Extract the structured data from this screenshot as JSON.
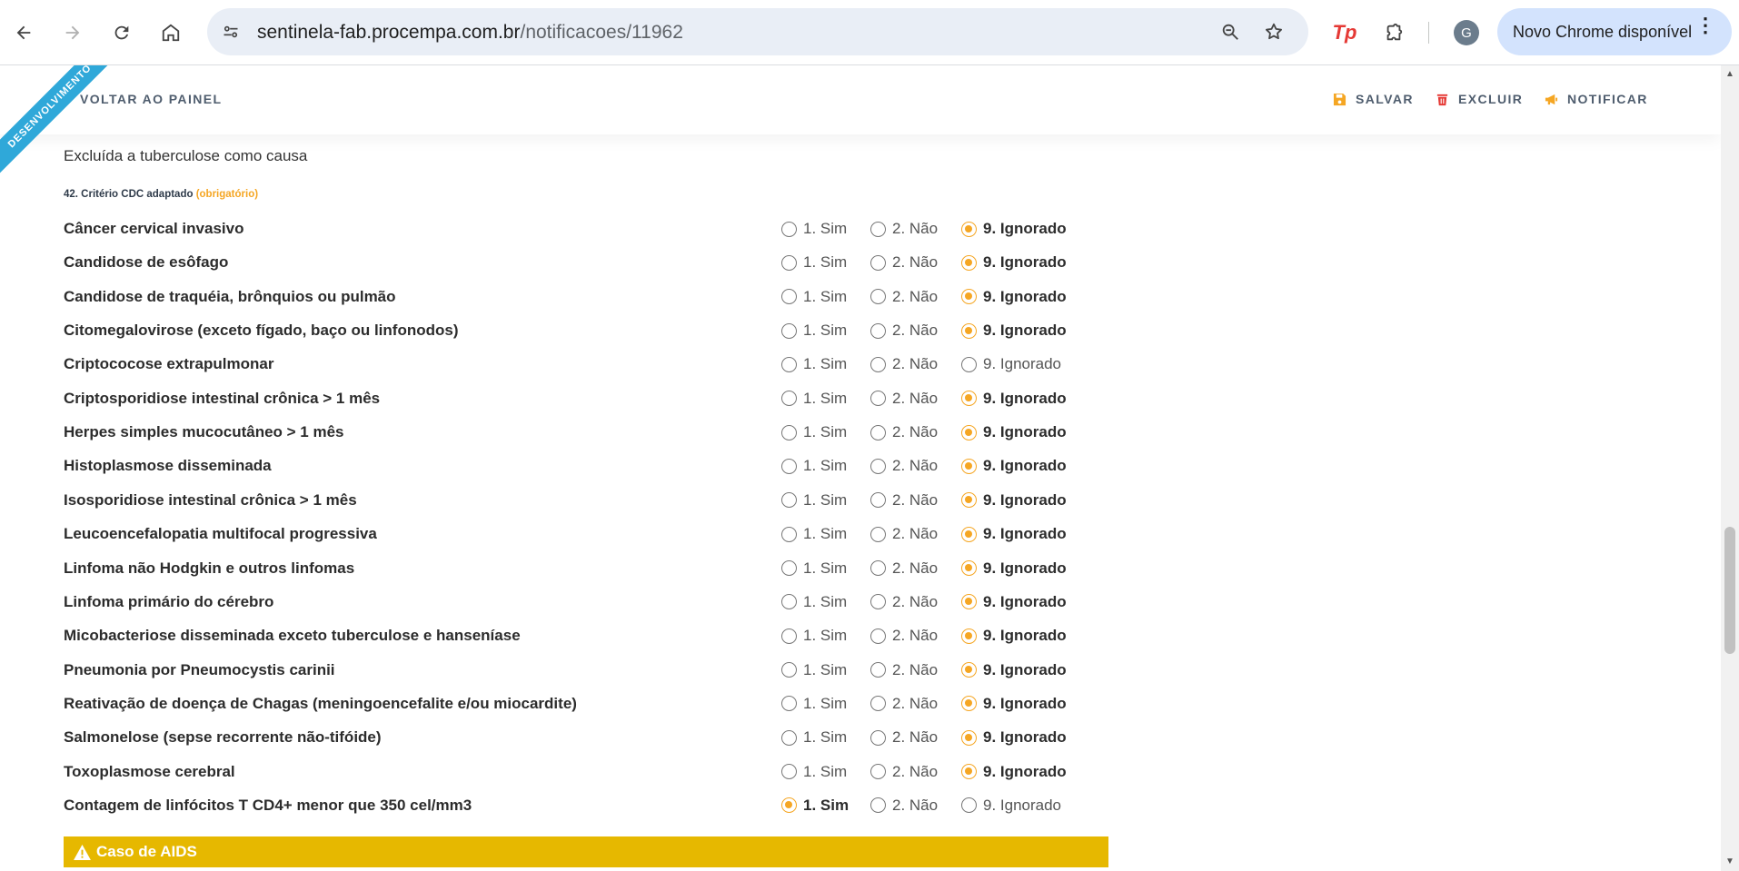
{
  "browser": {
    "url_host": "sentinela-fab.procempa.com.br",
    "url_path": "/notificacoes/11962",
    "profile_initial": "G",
    "update_label": "Novo Chrome disponível"
  },
  "header": {
    "ribbon": "DESENVOLVIMENTO",
    "back_label": "VOLTAR AO PAINEL",
    "save_label": "SALVAR",
    "delete_label": "EXCLUIR",
    "notify_label": "NOTIFICAR",
    "accent_color": "#f5a623"
  },
  "form": {
    "previous_field_text": "Excluída a tuberculose como causa",
    "section_label": "42. Critério CDC adaptado",
    "section_required": "(obrigatório)",
    "options": [
      "1. Sim",
      "2. Não",
      "9. Ignorado"
    ],
    "rows": [
      {
        "label": "Câncer cervical invasivo",
        "selected": 2
      },
      {
        "label": "Candidose de esôfago",
        "selected": 2
      },
      {
        "label": "Candidose de traquéia, brônquios ou pulmão",
        "selected": 2
      },
      {
        "label": "Citomegalovirose (exceto fígado, baço ou linfonodos)",
        "selected": 2
      },
      {
        "label": "Criptococose extrapulmonar",
        "selected": -1
      },
      {
        "label": "Criptosporidiose intestinal crônica > 1 mês",
        "selected": 2
      },
      {
        "label": "Herpes simples mucocutâneo > 1 mês",
        "selected": 2
      },
      {
        "label": "Histoplasmose disseminada",
        "selected": 2
      },
      {
        "label": "Isosporidiose intestinal crônica > 1 mês",
        "selected": 2
      },
      {
        "label": "Leucoencefalopatia multifocal progressiva",
        "selected": 2
      },
      {
        "label": "Linfoma não Hodgkin e outros linfomas",
        "selected": 2
      },
      {
        "label": "Linfoma primário do cérebro",
        "selected": 2
      },
      {
        "label": "Micobacteriose disseminada exceto tuberculose e hanseníase",
        "selected": 2
      },
      {
        "label": "Pneumonia por Pneumocystis carinii",
        "selected": 2
      },
      {
        "label": "Reativação de doença de Chagas (meningoencefalite e/ou miocardite)",
        "selected": 2
      },
      {
        "label": "Salmonelose (sepse recorrente não-tifóide)",
        "selected": 2
      },
      {
        "label": "Toxoplasmose cerebral",
        "selected": 2
      },
      {
        "label": "Contagem de linfócitos T CD4+ menor que 350 cel/mm3",
        "selected": 0
      }
    ],
    "aids_banner": "Caso de AIDS",
    "aids_color": "#e6b800"
  }
}
